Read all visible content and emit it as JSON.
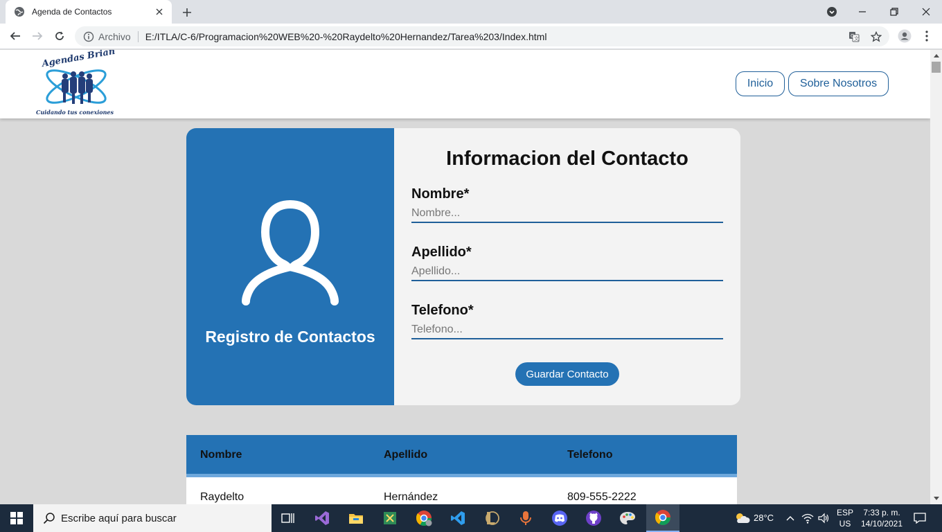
{
  "browser": {
    "tab_title": "Agenda de Contactos",
    "scheme_label": "Archivo",
    "url": "E:/ITLA/C-6/Programacion%20WEB%20-%20Raydelto%20Hernandez/Tarea%203/Index.html"
  },
  "site": {
    "logo_top_text": "Agendas Brian",
    "logo_bottom_text": "Cuidando tus conexiones",
    "nav": [
      "Inicio",
      "Sobre Nosotros"
    ]
  },
  "card": {
    "left_title": "Registro de Contactos",
    "form_title": "Informacion del Contacto",
    "fields": [
      {
        "label": "Nombre*",
        "placeholder": "Nombre..."
      },
      {
        "label": "Apellido*",
        "placeholder": "Apellido..."
      },
      {
        "label": "Telefono*",
        "placeholder": "Telefono..."
      }
    ],
    "save_label": "Guardar Contacto"
  },
  "table": {
    "headers": [
      "Nombre",
      "Apellido",
      "Telefono"
    ],
    "rows": [
      [
        "Raydelto",
        "Hernández",
        "809-555-2222"
      ]
    ]
  },
  "taskbar": {
    "search_placeholder": "Escribe aquí para buscar",
    "weather": "28°C",
    "lang_top": "ESP",
    "lang_bottom": "US",
    "time": "7:33 p. m.",
    "date": "14/10/2021"
  },
  "colors": {
    "primary_blue": "#2472b4",
    "header_border_blue": "#6ea8dc",
    "card_bg": "#f3f3f3",
    "page_bg": "#d9d9d9",
    "taskbar_bg": "#1c2b3d"
  },
  "icons": {
    "tab_favicon": "globe-icon",
    "avatar": "person-outline-icon"
  }
}
